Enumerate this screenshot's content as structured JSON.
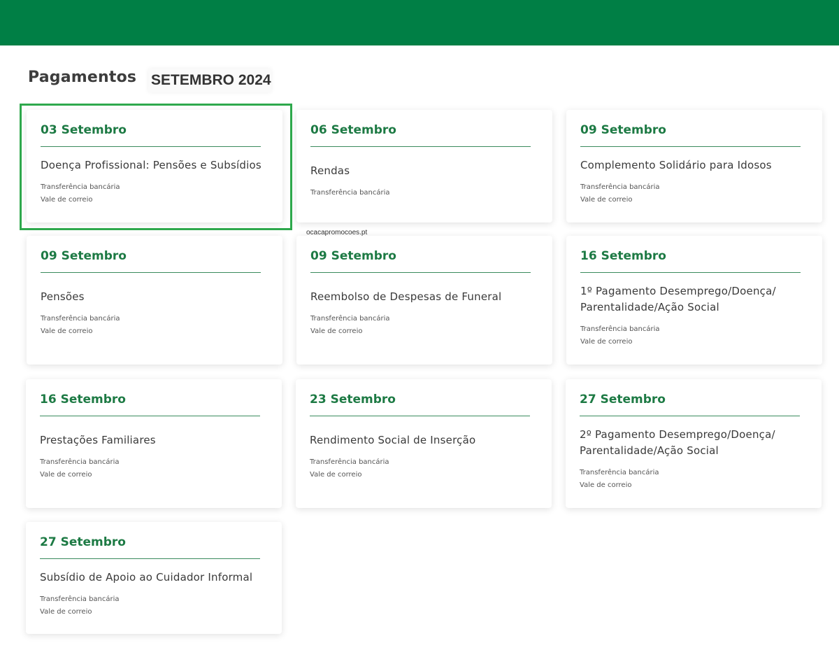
{
  "header": {
    "title": "Pagamentos",
    "month": "SETEMBRO 2024"
  },
  "watermark": "ocacapromocoes.pt",
  "cards": [
    {
      "date": "03 Setembro",
      "title": "Doença Profissional: Pensões e Subsídios",
      "methods": [
        "Transferência bancária",
        "Vale de correio"
      ]
    },
    {
      "date": "06 Setembro",
      "title": "Rendas",
      "methods": [
        "Transferência bancária"
      ]
    },
    {
      "date": "09 Setembro",
      "title": "Complemento Solidário para Idosos",
      "methods": [
        "Transferência bancária",
        "Vale de correio"
      ]
    },
    {
      "date": "09 Setembro",
      "title": "Pensões",
      "methods": [
        "Transferência bancária",
        "Vale de correio"
      ]
    },
    {
      "date": "09 Setembro",
      "title": "Reembolso de Despesas de Funeral",
      "methods": [
        "Transferência bancária",
        "Vale de correio"
      ]
    },
    {
      "date": "16 Setembro",
      "title": "1º Pagamento Desemprego/Doença/\nParentalidade/Ação Social",
      "methods": [
        "Transferência bancária",
        "Vale de correio"
      ]
    },
    {
      "date": "16 Setembro",
      "title": "Prestações Familiares",
      "methods": [
        "Transferência bancária",
        "Vale de correio"
      ]
    },
    {
      "date": "23 Setembro",
      "title": "Rendimento Social de Inserção",
      "methods": [
        "Transferência bancária",
        "Vale de correio"
      ]
    },
    {
      "date": "27 Setembro",
      "title": "2º Pagamento Desemprego/Doença/\nParentalidade/Ação Social",
      "methods": [
        "Transferência bancária",
        "Vale de correio"
      ]
    },
    {
      "date": "27 Setembro",
      "title": "Subsídio de Apoio ao Cuidador Informal",
      "methods": [
        "Transferência bancária",
        "Vale de correio"
      ]
    }
  ],
  "colors": {
    "brand": "#007f45",
    "accent": "#1d7a44",
    "highlight": "#2ea84c"
  }
}
